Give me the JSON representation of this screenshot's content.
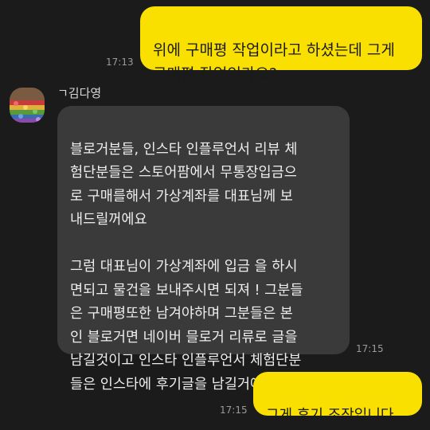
{
  "messages": {
    "outgoing_1": {
      "text": "위에 구매평 작업이라고 하셨는데 그게\n구매평 작업인가요?",
      "time": "17:13"
    },
    "incoming_1": {
      "sender": "ㄱ김다영",
      "text": "블로거분들, 인스타 인플루언서 리뷰 체\n험단분들은 스토어팜에서 무통장입금으\n로 구매를해서 가상계좌를 대표님께 보\n내드릴꺼에요\n\n그럼 대표님이 가상계좌에 입금 을 하시\n면되고 물건을 보내주시면 되져 ! 그분들\n은 구매평또한 남겨야하며 그분들은 본\n인 블로거면 네이버 믈로거 리류로 글을\n남길것이고 인스타 인플루언서 체험단분\n들은 인스타에 후기글을 남길거에여 !",
      "time": "17:15"
    },
    "outgoing_2": {
      "text": "그게 후기 조작입니다",
      "time": "17:15"
    }
  },
  "colors": {
    "background": "#1b1b1b",
    "outgoing_bubble": "#f9e000",
    "incoming_bubble": "#3a3a3a"
  },
  "icons": {
    "avatar": "flower-field-photo"
  }
}
